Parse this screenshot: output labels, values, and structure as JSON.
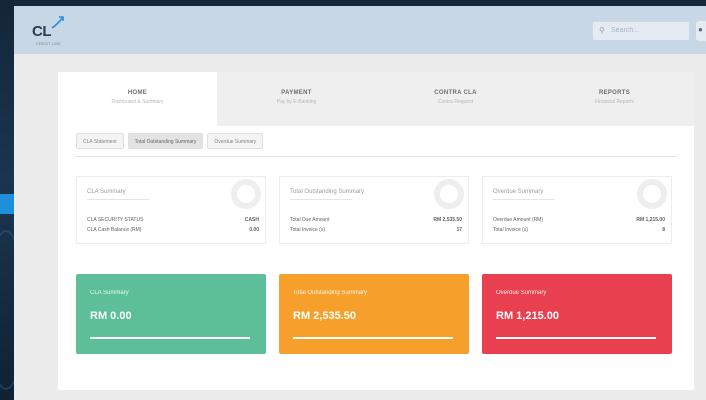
{
  "app": {
    "logo_text": "CL",
    "logo_sub": "CREDIT LINE",
    "search_placeholder": "Search..."
  },
  "tabs": [
    {
      "title": "HOME",
      "subtitle": "Dashboard & Summary",
      "active": true
    },
    {
      "title": "PAYMENT",
      "subtitle": "Pay by E-Banking",
      "active": false
    },
    {
      "title": "CONTRA CLA",
      "subtitle": "Contra Request",
      "active": false
    },
    {
      "title": "REPORTS",
      "subtitle": "Financial Reports",
      "active": false
    }
  ],
  "subtabs": [
    {
      "label": "CLA Statement",
      "active": false
    },
    {
      "label": "Total Outstanding Summary",
      "active": true
    },
    {
      "label": "Overdue Summary",
      "active": false
    }
  ],
  "cards": [
    {
      "title": "CLA Summary",
      "rows": [
        {
          "key": "CLA SECURITY STATUS",
          "value": "CASH"
        },
        {
          "key": "CLA Cash Balance (RM)",
          "value": "0.00"
        }
      ]
    },
    {
      "title": "Total Outstanding Summary",
      "rows": [
        {
          "key": "Total Due Amount",
          "value": "RM 2,535.50"
        },
        {
          "key": "Total Invoice (s)",
          "value": "17"
        }
      ]
    },
    {
      "title": "Overdue Summary",
      "rows": [
        {
          "key": "Overdue Amount (RM)",
          "value": "RM 1,215.00"
        },
        {
          "key": "Total Invoice (s)",
          "value": "8"
        }
      ]
    }
  ],
  "boxes": [
    {
      "title": "CLA Summary",
      "amount": "RM 0.00",
      "color": "#5cbf97",
      "progress": 1.0
    },
    {
      "title": "Total Outstanding Summary",
      "amount": "RM 2,535.50",
      "color": "#f6a02b",
      "progress": 1.0
    },
    {
      "title": "Overdue Summary",
      "amount": "RM 1,215.00",
      "color": "#e9404f",
      "progress": 1.0
    }
  ]
}
